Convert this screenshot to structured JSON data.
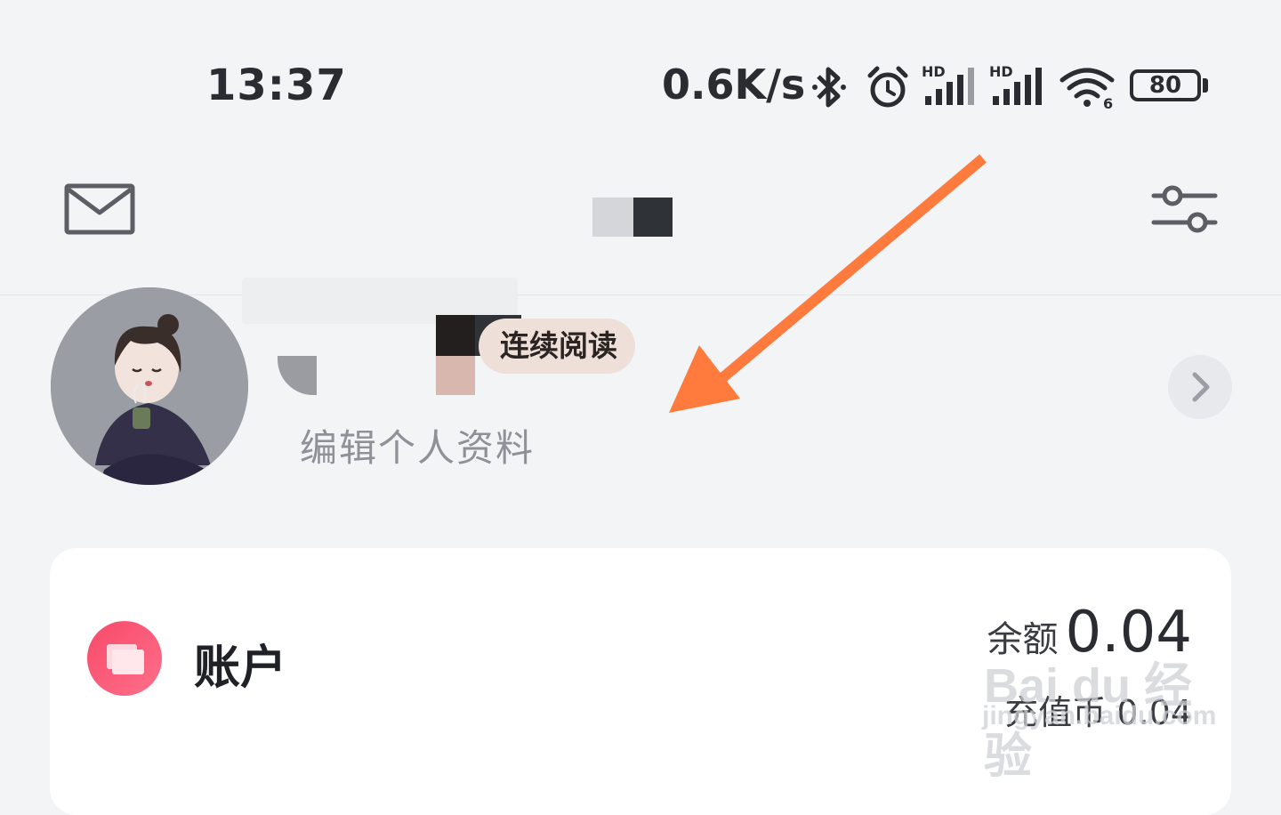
{
  "status_bar": {
    "time": "13:37",
    "net_speed": "0.6K/s",
    "signal_tag_1": "HD",
    "signal_tag_2": "HD",
    "wifi_tag": "6",
    "battery_level": "80",
    "icons": [
      "bluetooth-icon",
      "alarm-icon",
      "signal-icon",
      "signal-icon",
      "wifi-icon",
      "battery-icon"
    ]
  },
  "nav": {
    "left_icon": "mail-icon",
    "right_icon": "settings-sliders-icon"
  },
  "profile": {
    "badge_label": "连续阅读",
    "edit_label": "编辑个人资料",
    "arrow_icon": "chevron-right-icon"
  },
  "account": {
    "icon": "wallet-icon",
    "icon_color": "#f74a6a",
    "title": "账户",
    "balance_label": "余额",
    "balance_value": "0.04",
    "recharge_label": "充值币",
    "recharge_value": "0.04"
  },
  "watermark": {
    "main": "Bai du 经验",
    "sub": "jingyan.baidu.com"
  },
  "annotation": {
    "color": "#ff7a3d"
  }
}
